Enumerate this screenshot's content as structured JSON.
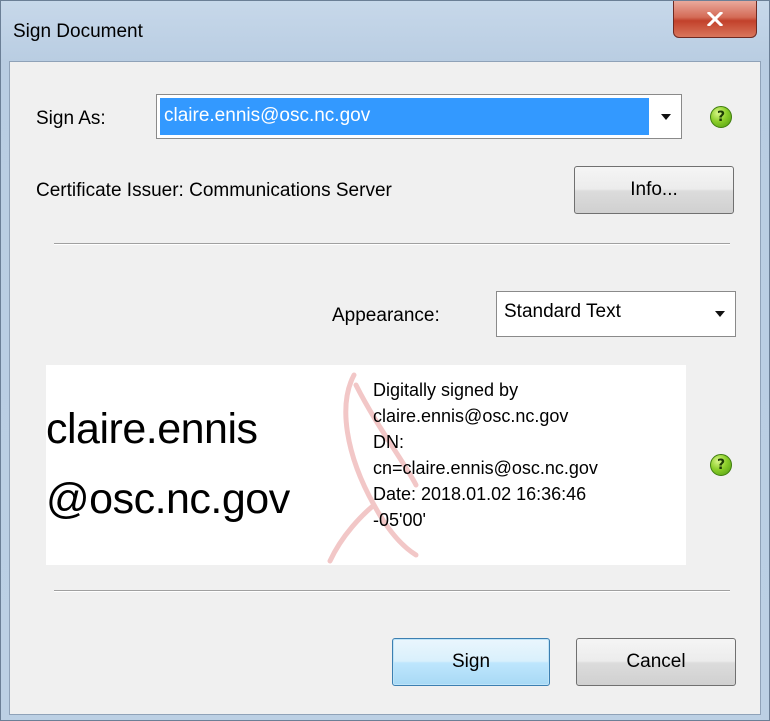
{
  "window": {
    "title": "Sign Document"
  },
  "sign_as": {
    "label": "Sign As:",
    "value": "claire.ennis@osc.nc.gov"
  },
  "certificate": {
    "issuer_text": "Certificate Issuer: Communications Server",
    "info_button": "Info..."
  },
  "appearance": {
    "label": "Appearance:",
    "value": "Standard Text"
  },
  "preview": {
    "name_line1": "claire.ennis",
    "name_line2": "@osc.nc.gov",
    "details": [
      "Digitally signed by",
      "claire.ennis@osc.nc.gov",
      "DN:",
      "cn=claire.ennis@osc.nc.gov",
      "Date: 2018.01.02 16:36:46",
      "-05'00'"
    ]
  },
  "help_icon_glyph": "?",
  "buttons": {
    "sign": "Sign",
    "cancel": "Cancel"
  },
  "colors": {
    "selection": "#3399ff",
    "help_icon": "#8ccf2a",
    "close_button": "#c2412b",
    "default_button_border": "#3c7fb1"
  },
  "icons": {
    "close": "close-icon",
    "dropdown": "chevron-down-icon",
    "help": "help-icon",
    "watermark": "acrobat-logo-icon"
  }
}
